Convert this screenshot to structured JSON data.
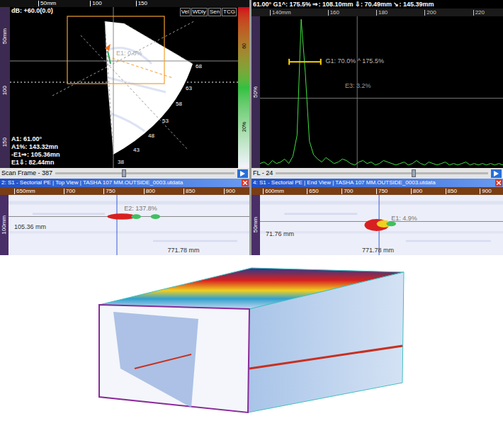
{
  "sector_view": {
    "ruler_top": [
      "50mm",
      "100",
      "150"
    ],
    "ruler_left": [
      "50mm",
      "100",
      "150"
    ],
    "gain": "dB: +60.0(0.0)",
    "buttons": [
      "Vel",
      "WDly",
      "Sen",
      "TCG"
    ],
    "indication": "E1: 0.8%",
    "angles": [
      "68",
      "63",
      "58",
      "53",
      "48",
      "43",
      "38"
    ],
    "readings": [
      "A1: 61.00°",
      "A1%: 143.32mn",
      "-E1⇒: 105.36mn",
      "E1⇩: 82.44mn"
    ],
    "palette_labels": [
      "60",
      "20%"
    ]
  },
  "ascan": {
    "readout": "61.00° G1^: 175.5% ⇒: 108.10mm ⇩: 70.49mm ↘: 145.39mm",
    "ruler_top": [
      "140mm",
      "160",
      "180",
      "200",
      "220"
    ],
    "ruler_left": [
      "50%"
    ],
    "gate": {
      "label": "G1: 70.0% ^ 175.5%",
      "level": 0.7
    },
    "indication": "E3: 3.2%",
    "series": [
      3,
      4,
      2,
      5,
      3,
      4,
      6,
      3,
      8,
      22,
      100,
      64,
      18,
      9,
      6,
      4,
      7,
      5,
      3,
      4,
      6,
      5,
      3,
      2,
      4,
      5,
      3,
      4,
      2,
      3,
      5,
      4,
      3,
      2,
      3,
      4,
      2,
      3,
      5,
      3,
      2,
      4,
      3,
      2,
      3,
      4,
      2,
      3,
      2,
      3,
      4,
      2,
      3,
      2,
      3,
      2,
      3,
      2,
      3,
      2
    ]
  },
  "sliders": [
    {
      "label": "Scan Frame - 387",
      "level": 0.37
    },
    {
      "label": "FL - 24",
      "level": 0.64
    }
  ],
  "views": [
    {
      "title": "2: S1 - Sectorial PE | Top View | TASHA 107 MM.OUTSIDE_0003.utdata",
      "ruler": [
        "650mm",
        "700",
        "750",
        "800",
        "850",
        "900"
      ],
      "ruler_left": [
        "100mm"
      ],
      "indication": "E2: 137.8%",
      "depth": "105.36 mm",
      "position": "771.78 mm"
    },
    {
      "title": "4: S1 - Sectorial PE | End View | TASHA 107 MM.OUTSIDE_0003.utdata",
      "ruler": [
        "600mm",
        "650",
        "700",
        "750",
        "800",
        "850",
        "900"
      ],
      "ruler_left": [
        "50mm"
      ],
      "indication": "E1: 4.9%",
      "depth": "71.76 mm",
      "position": "771.78 mm"
    }
  ]
}
